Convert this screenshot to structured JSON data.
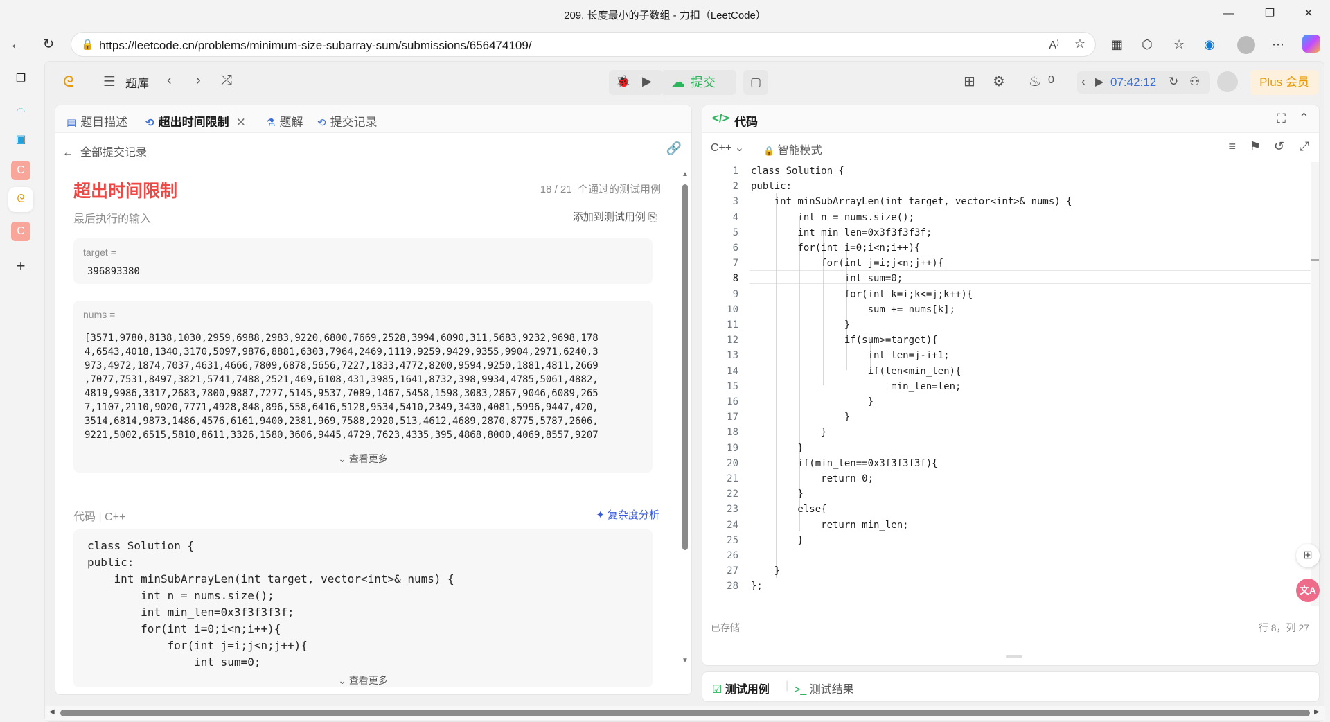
{
  "window": {
    "title": "209. 长度最小的子数组 - 力扣（LeetCode）"
  },
  "browser": {
    "url": "https://leetcode.cn/problems/minimum-size-subarray-sum/submissions/656474109/"
  },
  "header": {
    "problem_list": "题库",
    "submit": "提交",
    "streak": "0",
    "timer": "07:42:12",
    "plus": "Plus 会员"
  },
  "left_tabs": [
    {
      "label": "题目描述",
      "icon": "doc-icon"
    },
    {
      "label": "超出时间限制",
      "icon": "history-icon",
      "active": true
    },
    {
      "label": "题解",
      "icon": "flask-icon"
    },
    {
      "label": "提交记录",
      "icon": "history-icon"
    }
  ],
  "submission": {
    "back_label": "全部提交记录",
    "status": "超出时间限制",
    "passed": "18 / 21",
    "passed_suffix": "个通过的测试用例",
    "last_input_label": "最后执行的输入",
    "add_testcase": "添加到测试用例",
    "target_label": "target =",
    "target_value": "396893380",
    "nums_label": "nums =",
    "nums_lines": [
      "[3571,9780,8138,1030,2959,6988,2983,9220,6800,7669,2528,3994,6090,311,5683,9232,9698,178",
      "4,6543,4018,1340,3170,5097,9876,8881,6303,7964,2469,1119,9259,9429,9355,9904,2971,6240,3",
      "973,4972,1874,7037,4631,4666,7809,6878,5656,7227,1833,4772,8200,9594,9250,1881,4811,2669",
      ",7077,7531,8497,3821,5741,7488,2521,469,6108,431,3985,1641,8732,398,9934,4785,5061,4882,",
      "4819,9986,3317,2683,7800,9887,7277,5145,9537,7089,1467,5458,1598,3083,2867,9046,6089,265",
      "7,1107,2110,9020,7771,4928,848,896,558,6416,5128,9534,5410,2349,3430,4081,5996,9447,420,",
      "3514,6814,9873,1486,4576,6161,9400,2381,969,7588,2920,513,4612,4689,2870,8775,5787,2606,",
      "9221,5002,6515,5810,8611,3326,1580,3606,9445,4729,7623,4335,395,4868,8000,4069,8557,9207"
    ],
    "see_more": "查看更多",
    "code_label": "代码",
    "code_lang": "C++",
    "complexity": "复杂度分析",
    "code_preview": [
      "class Solution {",
      "public:",
      "    int minSubArrayLen(int target, vector<int>& nums) {",
      "        int n = nums.size();",
      "        int min_len=0x3f3f3f3f;",
      "        for(int i=0;i<n;i++){",
      "            for(int j=i;j<n;j++){",
      "                int sum=0;"
    ]
  },
  "editor": {
    "title": "代码",
    "language": "C++",
    "mode": "智能模式",
    "saved": "已存储",
    "cursor": "行 8，列 27",
    "lines": [
      "class Solution {",
      "public:",
      "    int minSubArrayLen(int target, vector<int>& nums) {",
      "        int n = nums.size();",
      "        int min_len=0x3f3f3f3f;",
      "        for(int i=0;i<n;i++){",
      "            for(int j=i;j<n;j++){",
      "                int sum=0;",
      "                for(int k=i;k<=j;k++){",
      "                    sum += nums[k];",
      "                }",
      "                if(sum>=target){",
      "                    int len=j-i+1;",
      "                    if(len<min_len){",
      "                        min_len=len;",
      "                    }",
      "                }",
      "            }",
      "        }",
      "        if(min_len==0x3f3f3f3f){",
      "            return 0;",
      "        }",
      "        else{",
      "            return min_len;",
      "        }",
      "",
      "    }",
      "};"
    ]
  },
  "bottom_tabs": [
    {
      "label": "测试用例",
      "active": true
    },
    {
      "label": "测试结果"
    }
  ],
  "colors": {
    "error": "#ef4743",
    "submit": "#2db55d",
    "plus": "#e69a0a",
    "accent": "#3b5bdb"
  }
}
